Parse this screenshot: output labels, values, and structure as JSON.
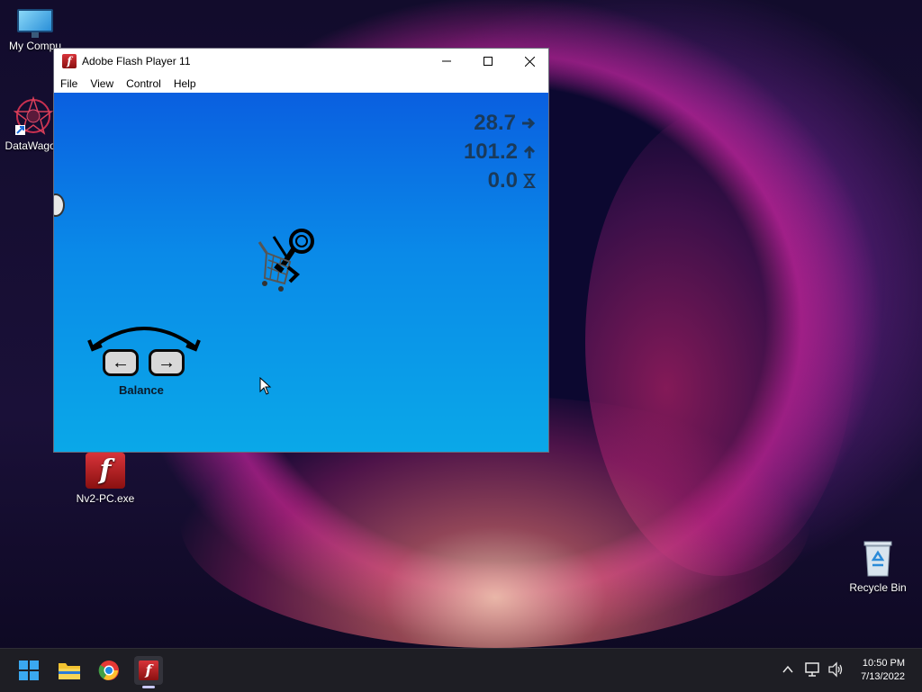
{
  "desktop": {
    "icons": [
      {
        "label": "My Compu"
      },
      {
        "label": "DataWagon"
      },
      {
        "label": "Nv2-PC.exe"
      },
      {
        "label": "Recycle Bin"
      }
    ]
  },
  "window": {
    "title": "Adobe Flash Player 11",
    "menu": [
      "File",
      "View",
      "Control",
      "Help"
    ]
  },
  "game": {
    "hud": {
      "distance": "28.7",
      "height": "101.2",
      "air": "0.0"
    },
    "balance_label": "Balance",
    "left_key": "←",
    "right_key": "→"
  },
  "taskbar": {
    "time": "10:50 PM",
    "date": "7/13/2022"
  },
  "colors": {
    "flash_red": "#c8282e",
    "game_blue": "#0a8ae8",
    "taskbar_bg": "#1e1e24"
  },
  "icons": [
    "windows-start-icon",
    "file-explorer-icon",
    "chrome-icon",
    "flash-player-icon",
    "chevron-up-icon",
    "network-icon",
    "volume-icon",
    "minimize-icon",
    "maximize-icon",
    "close-icon"
  ]
}
